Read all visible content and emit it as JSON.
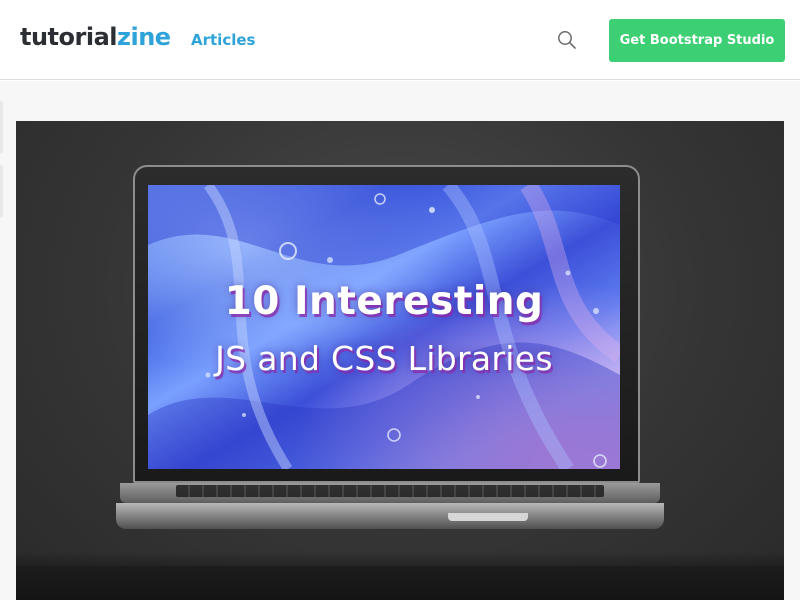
{
  "header": {
    "logo": {
      "main": "tutorial",
      "accent": "zine"
    },
    "nav": [
      {
        "label": "Articles"
      }
    ],
    "search": {
      "icon": "search-icon"
    },
    "cta": {
      "label": "Get Bootstrap Studio"
    }
  },
  "hero": {
    "image_text": {
      "line1": "10 Interesting",
      "line2": "JS and CSS Libraries"
    }
  },
  "colors": {
    "accent": "#2ea3d9",
    "cta_background": "#3ccf73",
    "logo_text": "#2b2f33"
  }
}
